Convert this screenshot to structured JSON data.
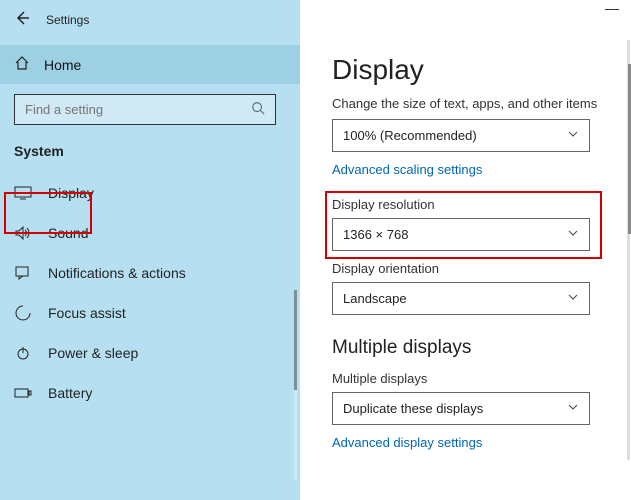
{
  "window": {
    "title": "Settings",
    "minimize": "—"
  },
  "sidebar": {
    "home": "Home",
    "search_placeholder": "Find a setting",
    "category": "System",
    "items": [
      "Display",
      "Sound",
      "Notifications & actions",
      "Focus assist",
      "Power & sleep",
      "Battery"
    ]
  },
  "main": {
    "heading": "Display",
    "scale_label": "Change the size of text, apps, and other items",
    "scale_value": "100% (Recommended)",
    "adv_scaling": "Advanced scaling settings",
    "res_label": "Display resolution",
    "res_value": "1366 × 768",
    "orient_label": "Display orientation",
    "orient_value": "Landscape",
    "multi_heading": "Multiple displays",
    "multi_label": "Multiple displays",
    "multi_value": "Duplicate these displays",
    "adv_display": "Advanced display settings"
  }
}
